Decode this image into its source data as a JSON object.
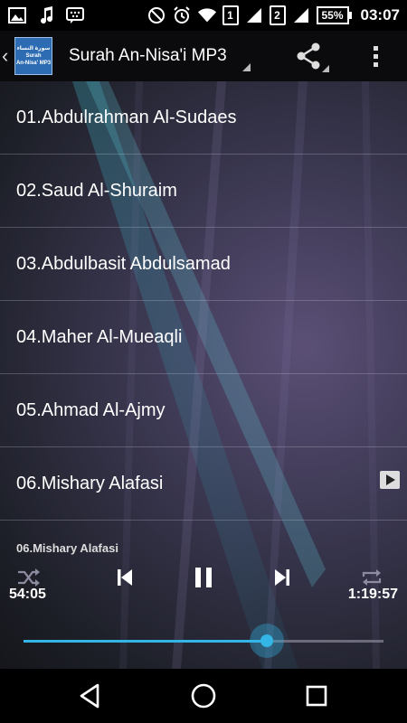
{
  "status_bar": {
    "sim1": "1",
    "sim2": "2",
    "battery": "55%",
    "time": "03:07",
    "icons": [
      "image-icon",
      "music-note-icon",
      "bbm-icon",
      "do-not-disturb-icon",
      "alarm-icon",
      "wifi-icon",
      "signal-icon"
    ]
  },
  "app_bar": {
    "logo_arabic": "سورة النساء",
    "logo_line1": "Surah",
    "logo_line2": "An-Nisa' MP3",
    "title": "Surah An-Nisa'i MP3",
    "icons": [
      "back-chevron-icon",
      "share-icon",
      "overflow-menu-icon"
    ]
  },
  "reciters": [
    {
      "label": "01.Abdulrahman Al-Sudaes"
    },
    {
      "label": "02.Saud Al-Shuraim"
    },
    {
      "label": "03.Abdulbasit Abdulsamad"
    },
    {
      "label": "04.Maher Al-Mueaqli"
    },
    {
      "label": "05.Ahmad Al-Ajmy"
    },
    {
      "label": "06.Mishary Alafasi",
      "playing": true
    }
  ],
  "player": {
    "now_playing": "06.Mishary Alafasi",
    "elapsed": "54:05",
    "duration": "1:19:57",
    "progress": 0.676,
    "accent_color": "#33b5e5",
    "icons": [
      "shuffle-icon",
      "previous-icon",
      "pause-icon",
      "next-icon",
      "repeat-icon"
    ]
  },
  "nav_bar": {
    "icons": [
      "back-icon",
      "home-icon",
      "recents-icon"
    ]
  }
}
